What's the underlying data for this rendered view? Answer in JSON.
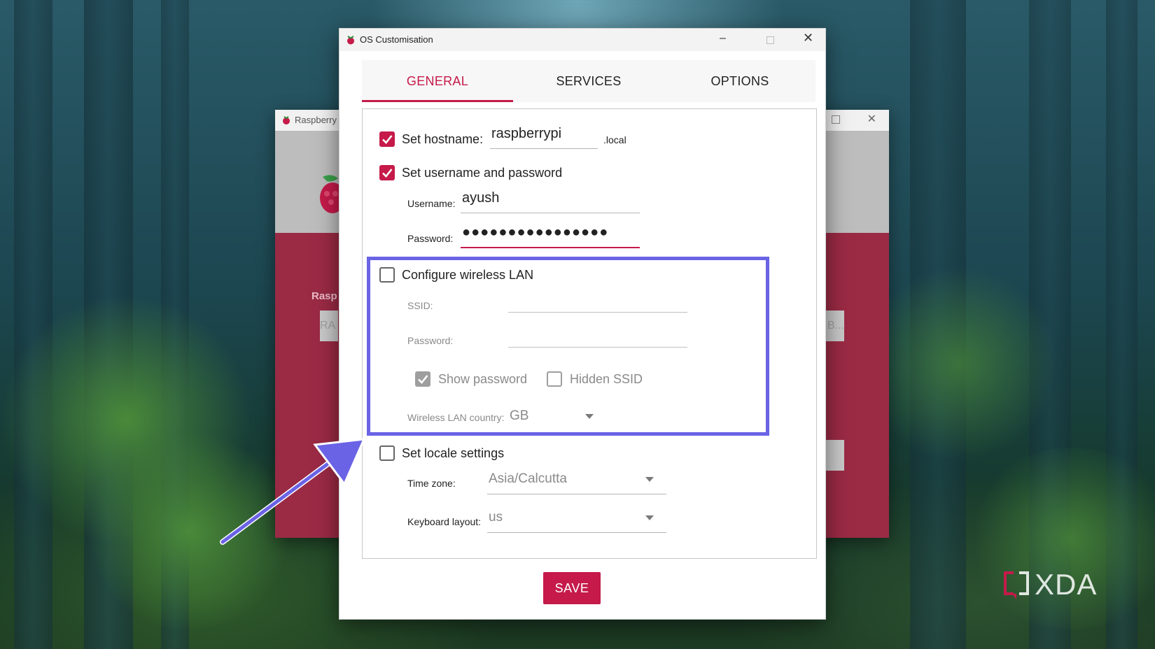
{
  "background_window": {
    "title": "Raspberry",
    "label_partial": "Rasp",
    "button_left_partial": "RA",
    "button_right_partial": "B..."
  },
  "dialog": {
    "title": "OS Customisation",
    "tabs": [
      {
        "label": "GENERAL",
        "active": true
      },
      {
        "label": "SERVICES",
        "active": false
      },
      {
        "label": "OPTIONS",
        "active": false
      }
    ]
  },
  "general": {
    "hostname": {
      "label": "Set hostname:",
      "checked": true,
      "value": "raspberrypi",
      "suffix": ".local"
    },
    "user": {
      "label": "Set username and password",
      "checked": true,
      "username_label": "Username:",
      "username_value": "ayush",
      "password_label": "Password:",
      "password_value": "●●●●●●●●●●●●●●●●"
    },
    "wlan": {
      "label": "Configure wireless LAN",
      "checked": false,
      "ssid_label": "SSID:",
      "ssid_value": "",
      "password_label": "Password:",
      "password_value": "",
      "show_password_label": "Show password",
      "show_password_checked": true,
      "hidden_ssid_label": "Hidden SSID",
      "hidden_ssid_checked": false,
      "country_label": "Wireless LAN country:",
      "country_value": "GB"
    },
    "locale": {
      "label": "Set locale settings",
      "checked": false,
      "timezone_label": "Time zone:",
      "timezone_value": "Asia/Calcutta",
      "keyboard_label": "Keyboard layout:",
      "keyboard_value": "us"
    }
  },
  "save_label": "SAVE",
  "watermark": "XDA",
  "colors": {
    "accent": "#c51a4a",
    "highlight": "#6a63e6"
  }
}
